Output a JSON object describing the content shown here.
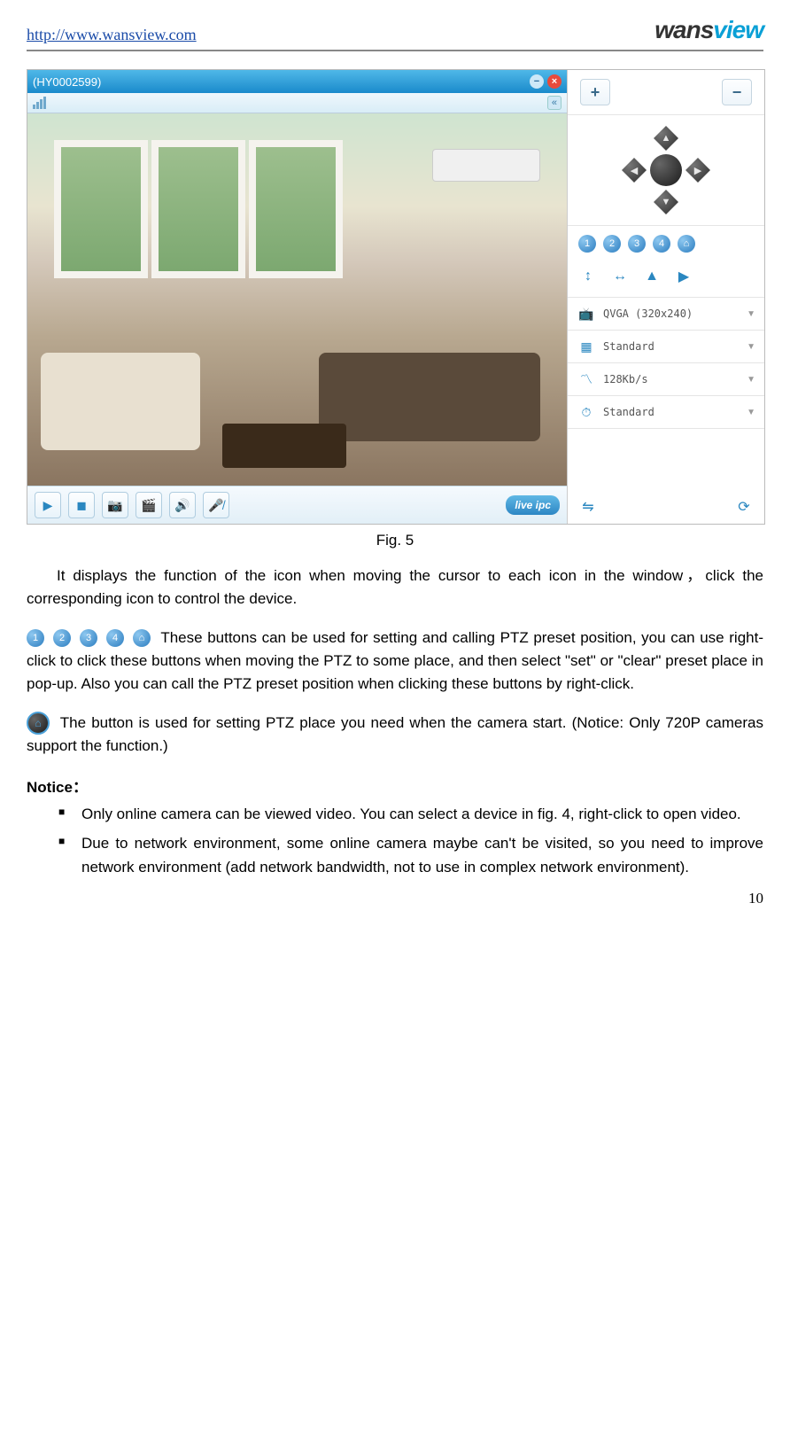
{
  "header": {
    "url": "http://www.wansview.com",
    "brand": "wansview"
  },
  "screenshot": {
    "title": "(HY0002599)",
    "collapse": "«",
    "zoom": {
      "plus": "+",
      "minus": "−"
    },
    "presets": [
      "1",
      "2",
      "3",
      "4"
    ],
    "home": "⌂",
    "settings": {
      "resolution": "QVGA (320x240)",
      "quality": "Standard",
      "bitrate": "128Kb/s",
      "fps": "Standard"
    },
    "liveipc": "live ipc"
  },
  "caption": "Fig. 5",
  "para1": "It displays the function of the icon when moving the cursor to each icon in the window，click the corresponding icon to control the device.",
  "para2a": " These buttons can be used for setting and calling PTZ preset position, you can use right-click to click these buttons when moving the PTZ to some place, and then select \"set\" or \"clear\" preset place in pop-up. Also you can call the PTZ preset position when clicking these buttons by right-click.",
  "para3": " The button is used for setting PTZ place you need when the camera start. (Notice: Only 720P cameras support the function.)",
  "notice_h": "Notice：",
  "notice": [
    "Only online camera can be viewed video. You can select a device in fig. 4, right-click to open video.",
    "Due to network environment, some online camera maybe can't be visited, so you need to improve network environment (add network bandwidth, not to use in complex network environment)."
  ],
  "page_num": "10"
}
